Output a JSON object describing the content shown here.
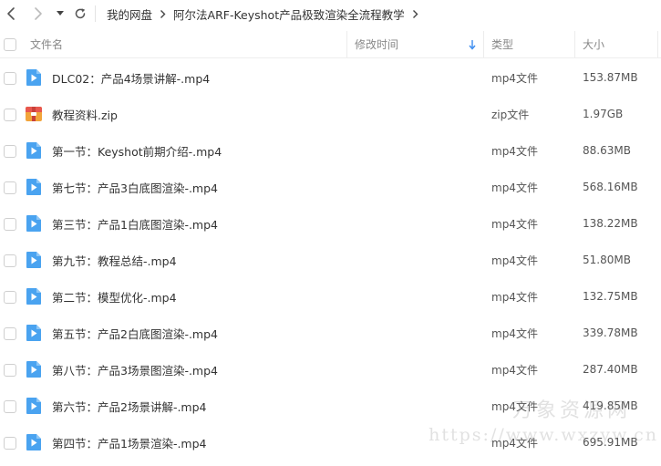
{
  "breadcrumb": [
    "我的网盘",
    "阿尔法ARF-Keyshot产品极致渲染全流程教学"
  ],
  "header": {
    "name": "文件名",
    "modified": "修改时间",
    "type": "类型",
    "size": "大小"
  },
  "files": [
    {
      "name": "DLC02：产品4场景讲解-.mp4",
      "type": "mp4文件",
      "size": "153.87MB",
      "icon": "video-file-icon"
    },
    {
      "name": "教程资料.zip",
      "type": "zip文件",
      "size": "1.97GB",
      "icon": "zip-file-icon"
    },
    {
      "name": "第一节：Keyshot前期介绍-.mp4",
      "type": "mp4文件",
      "size": "88.63MB",
      "icon": "video-file-icon"
    },
    {
      "name": "第七节：产品3白底图渲染-.mp4",
      "type": "mp4文件",
      "size": "568.16MB",
      "icon": "video-file-icon"
    },
    {
      "name": "第三节：产品1白底图渲染-.mp4",
      "type": "mp4文件",
      "size": "138.22MB",
      "icon": "video-file-icon"
    },
    {
      "name": "第九节：教程总结-.mp4",
      "type": "mp4文件",
      "size": "51.80MB",
      "icon": "video-file-icon"
    },
    {
      "name": "第二节：模型优化-.mp4",
      "type": "mp4文件",
      "size": "132.75MB",
      "icon": "video-file-icon"
    },
    {
      "name": "第五节：产品2白底图渲染-.mp4",
      "type": "mp4文件",
      "size": "339.78MB",
      "icon": "video-file-icon"
    },
    {
      "name": "第八节：产品3场景图渲染-.mp4",
      "type": "mp4文件",
      "size": "287.40MB",
      "icon": "video-file-icon"
    },
    {
      "name": "第六节：产品2场景讲解-.mp4",
      "type": "mp4文件",
      "size": "419.85MB",
      "icon": "video-file-icon"
    },
    {
      "name": "第四节：产品1场景渲染-.mp4",
      "type": "mp4文件",
      "size": "695.91MB",
      "icon": "video-file-icon"
    }
  ],
  "watermark": {
    "line1": "万象资源网",
    "line2": "https://www.wxzyw.cn"
  },
  "colors": {
    "video_icon": "#4aa3f0",
    "sort_arrow": "#3b8cf0",
    "zip_icon_red": "#e8574e",
    "zip_icon_orange": "#f2a43a"
  }
}
